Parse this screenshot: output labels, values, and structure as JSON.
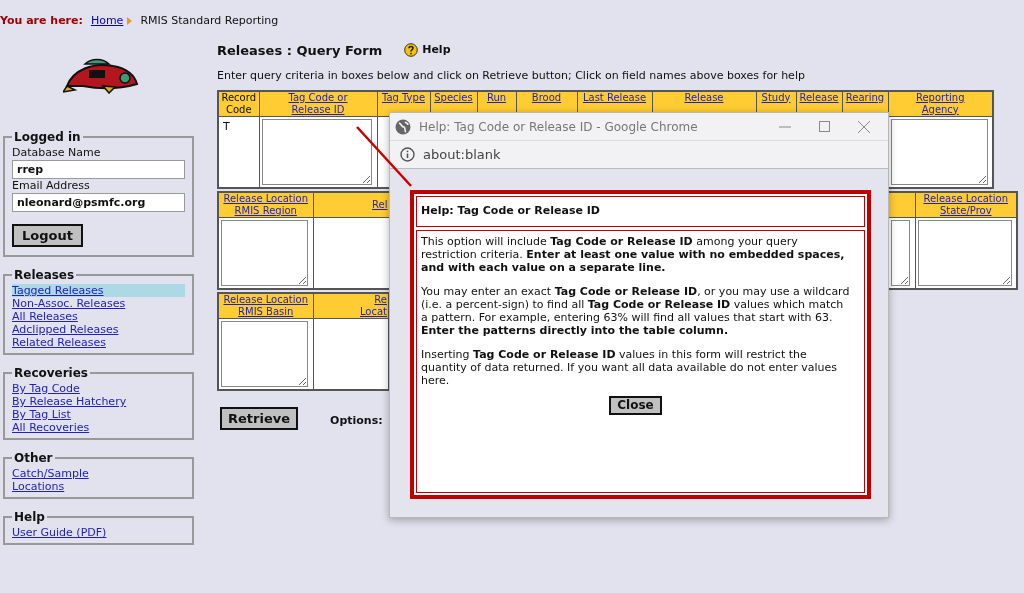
{
  "breadcrumb": {
    "label": "You are here:",
    "items": [
      {
        "text": "Home",
        "kind": "link"
      },
      {
        "text": "RMIS Standard Reporting",
        "kind": "current"
      }
    ]
  },
  "sidebar": {
    "login": {
      "legend": "Logged in",
      "fields": [
        {
          "label": "Database Name",
          "value": "rrep"
        },
        {
          "label": "Email Address",
          "value": "nleonard@psmfc.org"
        }
      ],
      "button": "Logout"
    },
    "sections": [
      {
        "legend": "Releases",
        "items": [
          {
            "text": "Tagged Releases",
            "selected": true
          },
          {
            "text": "Non-Assoc. Releases",
            "selected": false
          },
          {
            "text": "All Releases",
            "selected": false
          },
          {
            "text": "Adclipped Releases",
            "selected": false
          },
          {
            "text": "Related Releases",
            "selected": false
          }
        ]
      },
      {
        "legend": "Recoveries",
        "items": [
          {
            "text": "By Tag Code",
            "selected": false
          },
          {
            "text": "By Release Hatchery",
            "selected": false
          },
          {
            "text": "By Tag List",
            "selected": false
          },
          {
            "text": "All Recoveries",
            "selected": false
          }
        ]
      },
      {
        "legend": "Other",
        "items": [
          {
            "text": "Catch/Sample",
            "selected": false
          },
          {
            "text": "Locations",
            "selected": false
          }
        ]
      },
      {
        "legend": "Help",
        "items": [
          {
            "text": "User Guide (PDF)",
            "selected": false
          }
        ]
      }
    ]
  },
  "main": {
    "title": "Releases : Query Form",
    "help_link": "Help",
    "instructions": "Enter query criteria in boxes below and click on Retrieve button; Click on field names above boxes for help",
    "tables": [
      {
        "columns": [
          {
            "header": "Record\nCode",
            "kind": "value",
            "value": "T"
          },
          {
            "header": "Tag Code or\nRelease ID",
            "kind": "field"
          },
          {
            "header": "Tag Type",
            "kind": "covered"
          },
          {
            "header": "Species",
            "kind": "covered"
          },
          {
            "header": "Run",
            "kind": "covered"
          },
          {
            "header": "Brood",
            "kind": "covered"
          },
          {
            "header": "Last Release",
            "kind": "covered"
          },
          {
            "header": "Release",
            "kind": "covered"
          },
          {
            "header": "Study",
            "kind": "covered"
          },
          {
            "header": "Release",
            "kind": "covered"
          },
          {
            "header": "Rearing",
            "kind": "covered"
          },
          {
            "header": "Reporting\nAgency",
            "kind": "field"
          }
        ]
      },
      {
        "columns": [
          {
            "header": "Release Location\nRMIS Region",
            "kind": "field"
          },
          {
            "header": "Rel",
            "kind": "covered"
          },
          {
            "kind": "covered"
          },
          {
            "kind": "field"
          },
          {
            "header": "Release Location\nState/Prov",
            "kind": "field"
          }
        ]
      },
      {
        "columns": [
          {
            "header": "Release Location\nRMIS Basin",
            "kind": "field"
          },
          {
            "header": "Re\nLocat",
            "kind": "covered"
          }
        ]
      }
    ],
    "retrieve_button": "Retrieve",
    "options_label": "Options:"
  },
  "popup": {
    "title": "Help: Tag Code or Release ID - Google Chrome",
    "address": "about:blank",
    "heading": "Help: Tag Code or Release ID",
    "paragraphs": [
      "This option will include **Tag Code or Release ID** among your query restriction criteria. **Enter at least one value with no embedded spaces, and with each value on a separate line.**",
      "You may enter an exact **Tag Code or Release ID**, or you may use a wildcard (i.e. a percent-sign) to find all **Tag Code or Release ID** values which match a pattern. For example, entering 63% will find all values that start with 63. **Enter the patterns directly into the table column.**",
      "Inserting **Tag Code or Release ID** values in this form will restrict the quantity of data returned. If you want all data available do not enter values here."
    ],
    "button": "Close"
  }
}
